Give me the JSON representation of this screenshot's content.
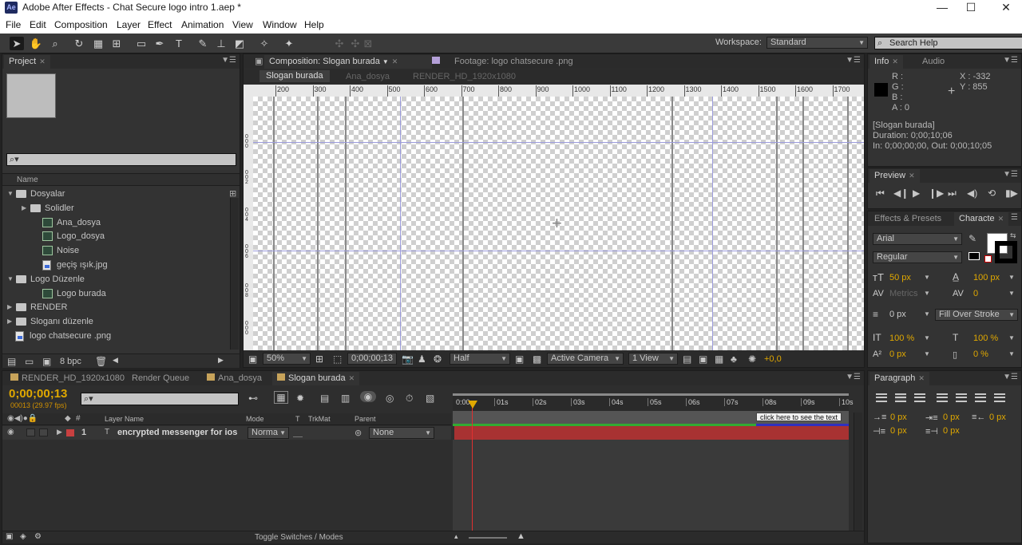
{
  "window": {
    "app_icon": "Ae",
    "title": "Adobe After Effects - Chat Secure logo intro 1.aep *",
    "minimize": "—",
    "maximize": "☐",
    "close": "✕"
  },
  "menu": [
    "File",
    "Edit",
    "Composition",
    "Layer",
    "Effect",
    "Animation",
    "View",
    "Window",
    "Help"
  ],
  "toolbar": {
    "workspace_label": "Workspace:",
    "workspace_value": "Standard",
    "search_placeholder": "Search Help"
  },
  "project": {
    "tab": "Project",
    "column_name": "Name",
    "bpc": "8 bpc",
    "items": [
      {
        "name": "Dosyalar",
        "type": "folder",
        "indent": 0,
        "open": true
      },
      {
        "name": "Solidler",
        "type": "folder",
        "indent": 1,
        "open": false
      },
      {
        "name": "Ana_dosya",
        "type": "comp",
        "indent": 1
      },
      {
        "name": "Logo_dosya",
        "type": "comp",
        "indent": 1
      },
      {
        "name": "Noise",
        "type": "comp",
        "indent": 1
      },
      {
        "name": "geçiş ışık.jpg",
        "type": "image",
        "indent": 1
      },
      {
        "name": "Logo Düzenle",
        "type": "folder",
        "indent": 0,
        "open": true
      },
      {
        "name": "Logo burada",
        "type": "comp",
        "indent": 1
      },
      {
        "name": "RENDER",
        "type": "folder",
        "indent": 0,
        "open": false
      },
      {
        "name": "Sloganı düzenle",
        "type": "folder",
        "indent": 0,
        "open": false
      },
      {
        "name": "logo chatsecure .png",
        "type": "image",
        "indent": 0
      }
    ]
  },
  "composition": {
    "tab_comp": "Composition: Slogan burada",
    "tab_footage": "Footage: logo chatsecure .png",
    "breadcrumbs": [
      "Slogan burada",
      "Ana_dosya",
      "RENDER_HD_1920x1080"
    ],
    "ruler_ticks": [
      "200",
      "300",
      "400",
      "500",
      "600",
      "700",
      "800",
      "900",
      "1000",
      "1100",
      "1200",
      "1300",
      "1400",
      "1500",
      "1600",
      "1700"
    ],
    "zoom": "50%",
    "timecode": "0;00;00;13",
    "resolution": "Half",
    "camera": "Active Camera",
    "views": "1 View",
    "exposure": "+0,0"
  },
  "info": {
    "tab_info": "Info",
    "tab_audio": "Audio",
    "r": "R :",
    "g": "G :",
    "b": "B :",
    "a": "A : 0",
    "x": "X : -332",
    "y": "Y : 855",
    "layer_name": "[Slogan burada]",
    "duration": "Duration: 0;00;10;06",
    "in_out": "In: 0;00;00;00, Out: 0;00;10;05"
  },
  "preview": {
    "tab": "Preview"
  },
  "effects_tab": "Effects & Presets",
  "character": {
    "tab": "Characte",
    "font": "Arial",
    "style": "Regular",
    "size": "50 px",
    "leading": "100 px",
    "kerning": "Metrics",
    "tracking": "0",
    "stroke_width": "0 px",
    "stroke_type": "Fill Over Stroke",
    "vscale": "100 %",
    "hscale": "100 %",
    "baseline": "0 px",
    "tsume": "0 %",
    "fill_color": "#ffffff",
    "stroke_color": "#000000"
  },
  "paragraph": {
    "tab": "Paragraph",
    "indent_left": "0 px",
    "indent_first": "0 px",
    "indent_right": "0 px",
    "space_before": "0 px",
    "space_after": "0 px"
  },
  "timeline": {
    "tabs": [
      "RENDER_HD_1920x1080",
      "Render Queue",
      "Ana_dosya",
      "Slogan burada"
    ],
    "timecode": "0;00;00;13",
    "frame_info": "00013 (29.97 fps)",
    "col_layer_name": "Layer Name",
    "col_mode": "Mode",
    "col_t": "T",
    "col_trkmat": "TrkMat",
    "col_parent": "Parent",
    "time_labels": [
      "0:00s",
      "01s",
      "02s",
      "03s",
      "04s",
      "05s",
      "06s",
      "07s",
      "08s",
      "09s",
      "10s"
    ],
    "hint": "click here to see the text",
    "toggle_label": "Toggle Switches / Modes",
    "layer": {
      "num": "1",
      "name": "encrypted messenger for ios",
      "mode": "Norma",
      "parent": "None",
      "color": "#c84040"
    }
  }
}
